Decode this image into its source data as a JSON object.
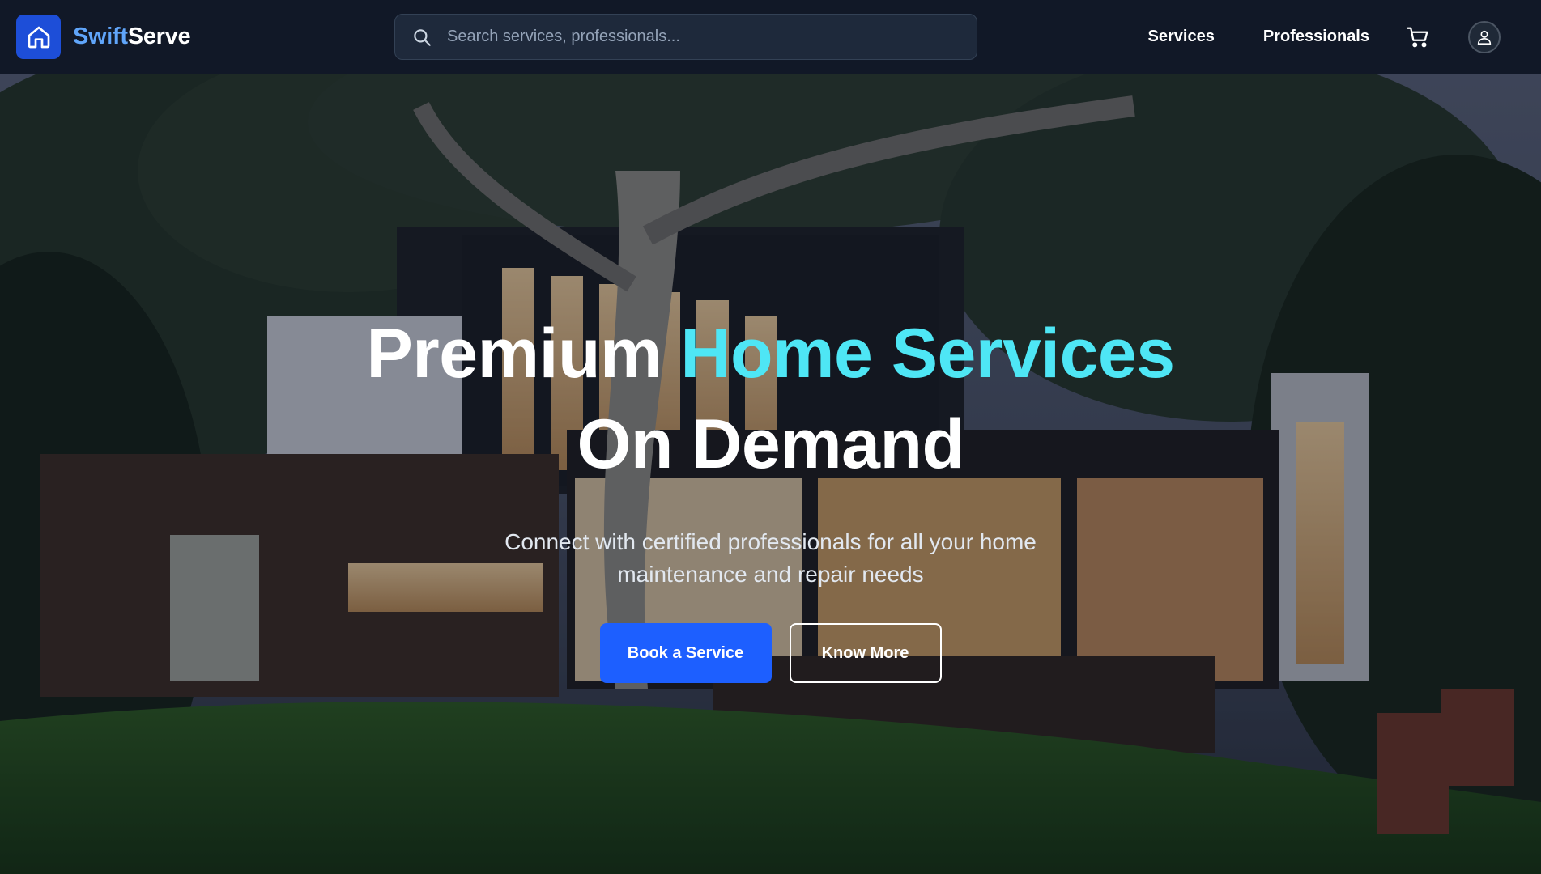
{
  "brand": {
    "name_part1": "Swift",
    "name_part2": "Serve",
    "logo_icon": "home-icon",
    "logo_bg": "#1d4ed8",
    "name_part1_color": "#60a5fa"
  },
  "search": {
    "placeholder": "Search services, professionals...",
    "value": "",
    "icon": "search-icon"
  },
  "nav": {
    "links": [
      "Services",
      "Professionals"
    ],
    "cart_icon": "cart-icon",
    "profile_icon": "user-icon"
  },
  "hero": {
    "title_part1": "Premium ",
    "title_accent": "Home Services",
    "title_part2": "On Demand",
    "subtitle": "Connect with certified professionals for all your home maintenance and repair needs",
    "primary_button": "Book a Service",
    "secondary_button": "Know More",
    "accent_color": "#4ee6f5",
    "primary_color": "#1d5fff",
    "background": "modern-house-at-dusk-photo"
  }
}
